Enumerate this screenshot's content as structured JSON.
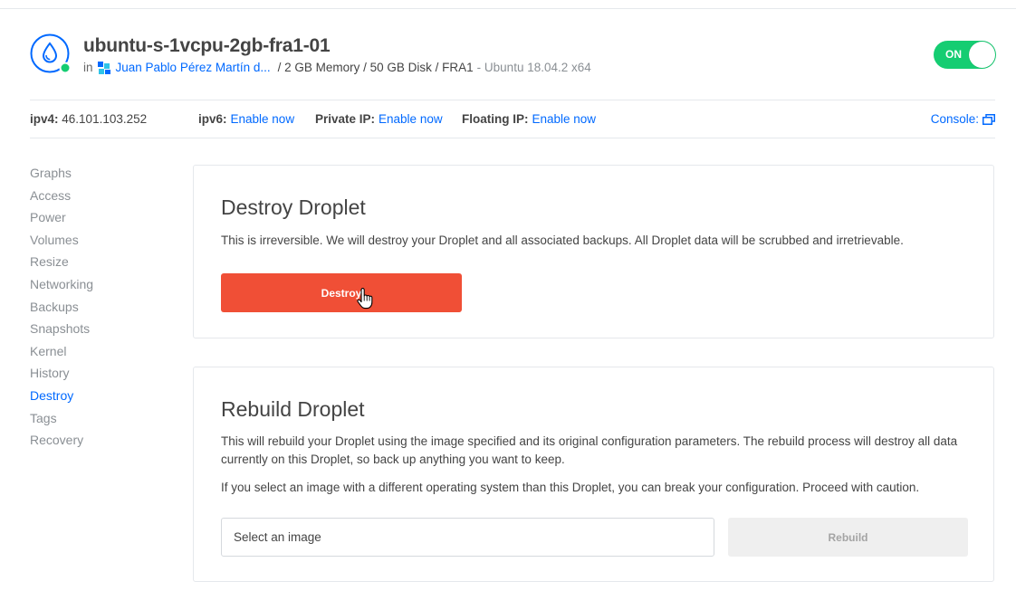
{
  "header": {
    "title": "ubuntu-s-1vcpu-2gb-fra1-01",
    "in_label": "in",
    "project_name": "Juan Pablo Pérez Martín d...",
    "specs": "/ 2 GB Memory / 50 GB Disk / FRA1",
    "os": "- Ubuntu 18.04.2 x64",
    "power_toggle": {
      "label": "ON",
      "state": "on",
      "color": "#15cd72"
    },
    "status_color": "#15cd72"
  },
  "ipbar": {
    "ipv4_label": "ipv4:",
    "ipv4_value": "46.101.103.252",
    "ipv6_label": "ipv6:",
    "ipv6_link": "Enable now",
    "private_label": "Private IP:",
    "private_link": "Enable now",
    "floating_label": "Floating IP:",
    "floating_link": "Enable now",
    "console_label": "Console:",
    "console_icon": "external-window-icon"
  },
  "sidebar": {
    "items": [
      {
        "label": "Graphs"
      },
      {
        "label": "Access"
      },
      {
        "label": "Power"
      },
      {
        "label": "Volumes"
      },
      {
        "label": "Resize"
      },
      {
        "label": "Networking"
      },
      {
        "label": "Backups"
      },
      {
        "label": "Snapshots"
      },
      {
        "label": "Kernel"
      },
      {
        "label": "History"
      },
      {
        "label": "Destroy",
        "active": true
      },
      {
        "label": "Tags"
      },
      {
        "label": "Recovery"
      }
    ]
  },
  "destroy": {
    "heading": "Destroy Droplet",
    "description": "This is irreversible. We will destroy your Droplet and all associated backups. All Droplet data will be scrubbed and irretrievable.",
    "button_label": "Destroy",
    "button_color": "#f04f36"
  },
  "rebuild": {
    "heading": "Rebuild Droplet",
    "description": "This will rebuild your Droplet using the image specified and its original configuration parameters. The rebuild process will destroy all data currently on this Droplet, so back up anything you want to keep.",
    "warning": "If you select an image with a different operating system than this Droplet, you can break your configuration. Proceed with caution.",
    "select_placeholder": "Select an image",
    "button_label": "Rebuild"
  },
  "colors": {
    "accent": "#0069ff",
    "muted": "#8a8f94"
  }
}
